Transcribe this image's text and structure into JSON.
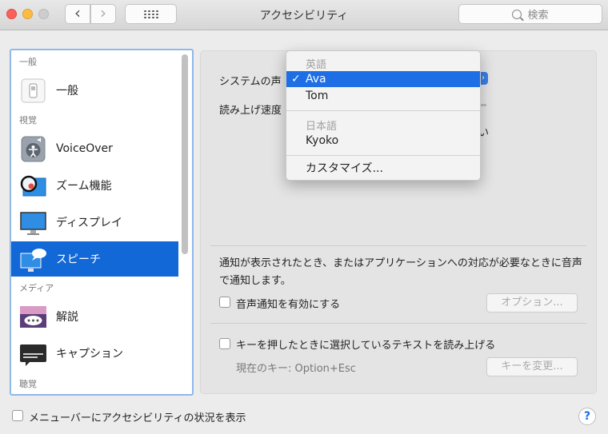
{
  "window": {
    "title": "アクセシビリティ",
    "back_icon": "‹",
    "forward_icon": "›",
    "search_placeholder": "検索"
  },
  "sidebar": {
    "sections": [
      {
        "header": "一般"
      },
      {
        "header": "視覚"
      },
      {
        "header": "メディア"
      },
      {
        "header": "聴覚"
      }
    ],
    "items": [
      {
        "label": "一般",
        "icon": "general-icon"
      },
      {
        "label": "VoiceOver",
        "icon": "voiceover-icon"
      },
      {
        "label": "ズーム機能",
        "icon": "zoom-icon"
      },
      {
        "label": "ディスプレイ",
        "icon": "display-icon"
      },
      {
        "label": "スピーチ",
        "icon": "speech-icon",
        "selected": true
      },
      {
        "label": "解説",
        "icon": "descriptions-icon"
      },
      {
        "label": "キャプション",
        "icon": "captions-icon"
      }
    ]
  },
  "speech": {
    "system_voice_label": "システムの声",
    "rate_label": "読み上げ速度",
    "rate_tail": "い",
    "announce_text": "通知が表示されたとき、またはアプリケーションへの対応が必要なときに音声で通知します。",
    "announce_checkbox": "音声通知を有効にする",
    "options_button": "オプション...",
    "speak_selection_checkbox": "キーを押したときに選択しているテキストを読み上げる",
    "current_key_label": "現在のキー: Option+Esc",
    "change_key_button": "キーを変更..."
  },
  "voice_menu": {
    "groups": [
      {
        "label": "英語",
        "items": [
          {
            "label": "Ava",
            "checked": true,
            "highlighted": true
          },
          {
            "label": "Tom"
          }
        ]
      },
      {
        "label": "日本語",
        "items": [
          {
            "label": "Kyoko"
          }
        ]
      }
    ],
    "customize": "カスタマイズ...",
    "check_mark": "✓"
  },
  "footer": {
    "menubar_checkbox": "メニューバーにアクセシビリティの状況を表示",
    "help_label": "?"
  },
  "colors": {
    "accent": "#1268d6",
    "menu_highlight": "#1e6ee6"
  }
}
